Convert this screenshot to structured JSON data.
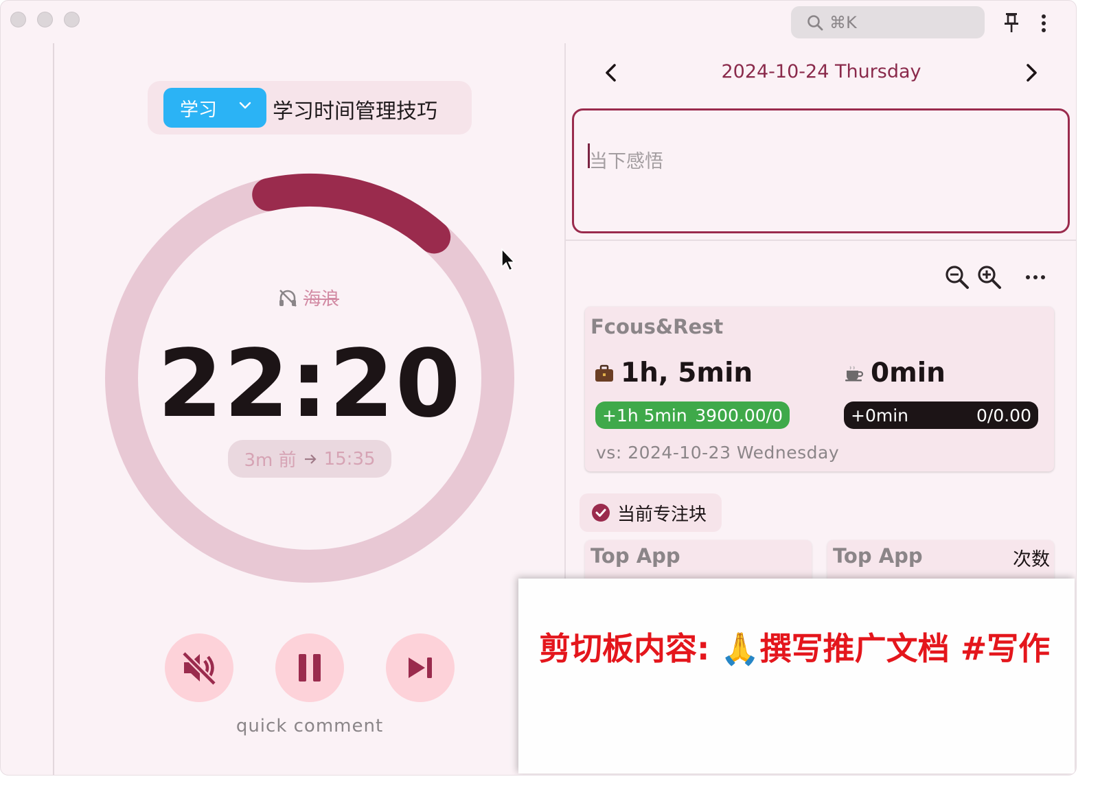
{
  "titlebar": {
    "search_shortcut": "⌘K"
  },
  "task": {
    "category": "学习",
    "title": "学习时间管理技巧"
  },
  "timer": {
    "sound_name": "海浪",
    "time": "22:20",
    "progress_fraction": 0.15,
    "ago": "3m 前",
    "end_time": "15:35"
  },
  "controls": {
    "quick_comment": "quick comment"
  },
  "daily": {
    "date": "2024-10-24 Thursday",
    "reflection_placeholder": "当下感悟"
  },
  "stats": {
    "title": "Fcous&Rest",
    "focus_total": "1h, 5min",
    "rest_total": "0min",
    "focus_delta": "+1h 5min",
    "focus_ratio": "3900.00/0",
    "rest_delta": "+0min",
    "rest_ratio": "0/0.00",
    "compare": "vs: 2024-10-23 Wednesday"
  },
  "current_block": {
    "label": "当前专注块"
  },
  "top_app": {
    "left_title": "Top App",
    "right_title": "Top App",
    "right_sort": "次数"
  },
  "clipboard": {
    "text": "剪切板内容: 🙏撰写推广文档 #写作"
  },
  "colors": {
    "accent": "#9a2b4d",
    "ring_track": "#e8c8d4",
    "category": "#2bb3f5",
    "green": "#3fa94a",
    "control_bg": "#fdd2d9"
  }
}
